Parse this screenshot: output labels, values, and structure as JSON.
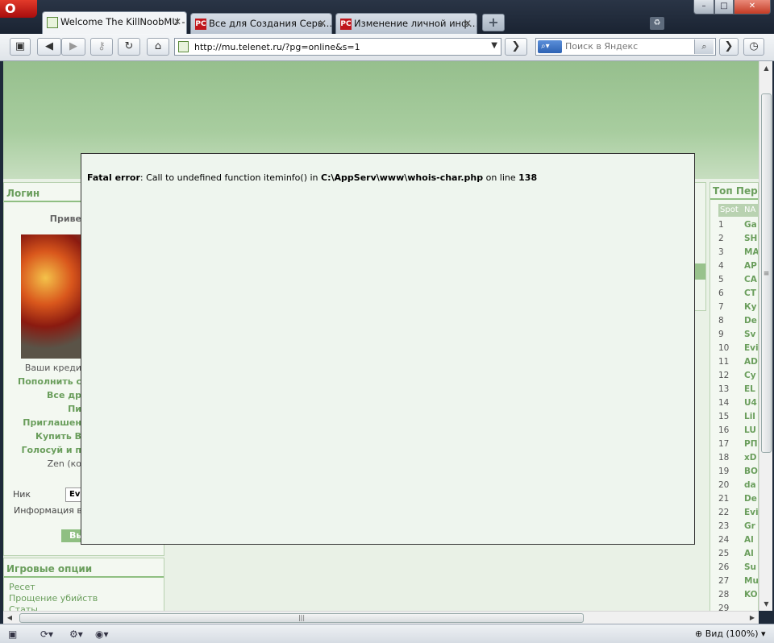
{
  "browser": {
    "menu_label": "O",
    "window_controls": {
      "minimize": "–",
      "maximize": "□",
      "close": "✕"
    },
    "tabs": [
      {
        "title": "Welcome The KillNoobMU -",
        "icon": "page-icon",
        "active": true
      },
      {
        "title": "Все для Создания Серв…",
        "icon": "pc-icon",
        "active": false
      },
      {
        "title": "Изменение личной инф…",
        "icon": "pc-icon",
        "active": false
      }
    ],
    "tab_icon_text": "PC",
    "tab_close": "✕",
    "new_tab": "+",
    "address": "http://mu.telenet.ru/?pg=online&s=1",
    "search_placeholder": "Поиск в Яндекс",
    "search_engine_icon": "magnifier-icon",
    "zoom_label": "Вид (100%)"
  },
  "page": {
    "login_title": "Логин",
    "greeting": "Приве",
    "credits": "Ваши креди",
    "links": [
      "Пополнить с",
      "Все др",
      "Пи",
      "Приглашен",
      "Купить В",
      "Голосуй и п"
    ],
    "zen": "Zen (ко",
    "nick_label": "Ник",
    "nick_value": "Ev",
    "info": "Информация ва",
    "exit_button": "Вы",
    "options_title": "Игровые опции",
    "options": [
      "Ресет",
      "Прощение убийств",
      "Статы"
    ],
    "top_title": "Топ Персо",
    "top_header": {
      "spot": "Spot",
      "name": "NA"
    },
    "top_rows": [
      {
        "spot": "1",
        "name": "Ga"
      },
      {
        "spot": "2",
        "name": "SH"
      },
      {
        "spot": "3",
        "name": "MA"
      },
      {
        "spot": "4",
        "name": "AP"
      },
      {
        "spot": "5",
        "name": "CA"
      },
      {
        "spot": "6",
        "name": "CT"
      },
      {
        "spot": "7",
        "name": "Ку"
      },
      {
        "spot": "8",
        "name": "De"
      },
      {
        "spot": "9",
        "name": "Sv"
      },
      {
        "spot": "10",
        "name": "Evi"
      },
      {
        "spot": "11",
        "name": "AD"
      },
      {
        "spot": "12",
        "name": "Cy"
      },
      {
        "spot": "13",
        "name": "EL"
      },
      {
        "spot": "14",
        "name": "U4"
      },
      {
        "spot": "15",
        "name": "Lil"
      },
      {
        "spot": "16",
        "name": "LU"
      },
      {
        "spot": "17",
        "name": "PП"
      },
      {
        "spot": "18",
        "name": "xD"
      },
      {
        "spot": "19",
        "name": "BO"
      },
      {
        "spot": "20",
        "name": "da"
      },
      {
        "spot": "21",
        "name": "De"
      },
      {
        "spot": "22",
        "name": "Evi"
      },
      {
        "spot": "23",
        "name": "Gr"
      },
      {
        "spot": "24",
        "name": "Al"
      },
      {
        "spot": "25",
        "name": "Al"
      },
      {
        "spot": "26",
        "name": "Su"
      },
      {
        "spot": "27",
        "name": "Mu"
      },
      {
        "spot": "28",
        "name": "KO"
      },
      {
        "spot": "29",
        "name": ""
      }
    ]
  },
  "error": {
    "label": "Fatal error",
    "message": ": Call to undefined function iteminfo() in ",
    "path": "C:\\AppServ\\www\\whois-char.php",
    "on_line": " on line ",
    "line": "138"
  },
  "colors": {
    "accent_green": "#6a9e5c",
    "header_green": "#96bf8d",
    "modal_bg": "#eef5ee"
  }
}
